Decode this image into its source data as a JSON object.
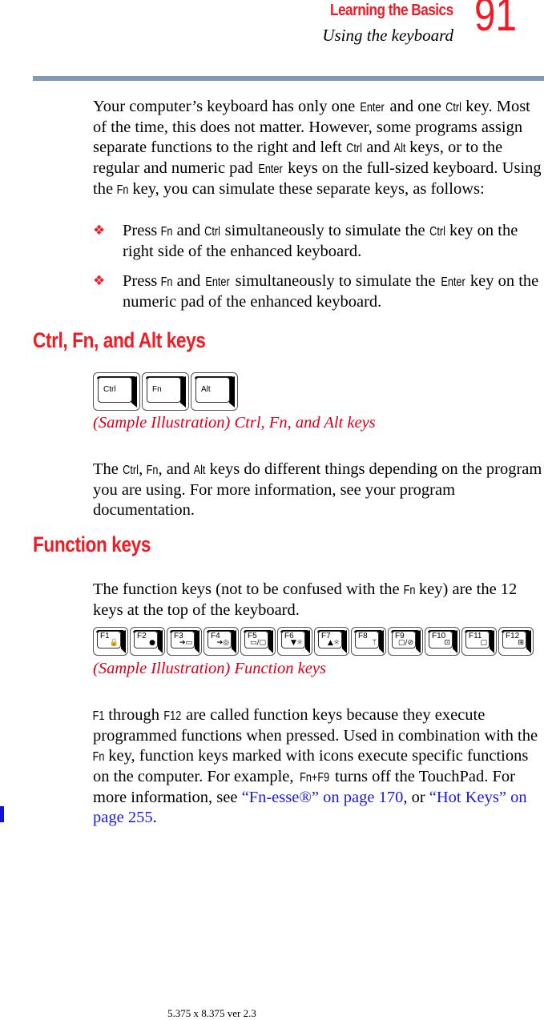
{
  "header": {
    "chapter": "Learning the Basics",
    "section": "Using the keyboard",
    "page_number": "91",
    "rule_color": "#7f9bb4",
    "accent_color": "#ee1c25"
  },
  "intro": {
    "s1": "Your computer’s keyboard has only one ",
    "k1": "Enter",
    "s2": " and one ",
    "k2": "Ctrl",
    "s3": " key. Most of the time, this does not matter. However, some programs assign separate functions to the right and left ",
    "k3": "Ctrl",
    "s4": " and ",
    "k4": "Alt",
    "s5": " keys, or to the regular and numeric pad ",
    "k5": "Enter",
    "s6": " keys on the full-sized keyboard. Using the ",
    "k6": "Fn",
    "s7": " key, you can simulate these separate keys, as follows:"
  },
  "bullets": [
    {
      "glyph": "❖",
      "s1": "Press ",
      "k1": "Fn",
      "s2": " and ",
      "k2": "Ctrl",
      "s3": " simultaneously to simulate the ",
      "k3": "Ctrl",
      "s4": " key on the right side of the enhanced keyboard."
    },
    {
      "glyph": "❖",
      "s1": "Press ",
      "k1": "Fn",
      "s2": " and ",
      "k2": "Enter",
      "s3": " simultaneously to simulate the ",
      "k3": "Enter",
      "s4": " key on the numeric pad of the enhanced keyboard."
    }
  ],
  "section1": {
    "heading": "Ctrl, Fn, and Alt keys",
    "keys": [
      "Ctrl",
      "Fn",
      "Alt"
    ],
    "caption": "(Sample Illustration) Ctrl, Fn, and Alt keys",
    "p": {
      "s1": "The ",
      "k1": "Ctrl",
      "s2": ", ",
      "k2": "Fn",
      "s3": ", and ",
      "k3": "Alt",
      "s4": " keys do different things depending on the program you are using. For more information, see your program documentation."
    }
  },
  "section2": {
    "heading": "Function keys",
    "p1": {
      "s1": "The function keys (not to be confused with the ",
      "k1": "Fn",
      "s2": " key) are the 12 keys at the top of the keyboard."
    },
    "fkeys": [
      {
        "label": "F1",
        "icon": "🔒",
        "icon_name": "lock-icon"
      },
      {
        "label": "F2",
        "icon": "●",
        "icon_name": "power-icon"
      },
      {
        "label": "F3",
        "icon": "➔▭",
        "icon_name": "standby-icon"
      },
      {
        "label": "F4",
        "icon": "➔◎",
        "icon_name": "hibernate-icon"
      },
      {
        "label": "F5",
        "icon": "▭/▢",
        "icon_name": "display-toggle-icon"
      },
      {
        "label": "F6",
        "icon": "▼☼",
        "icon_name": "brightness-down-icon"
      },
      {
        "label": "F7",
        "icon": "▲☼",
        "icon_name": "brightness-up-icon"
      },
      {
        "label": "F8",
        "icon": "ᛘ",
        "icon_name": "wireless-icon"
      },
      {
        "label": "F9",
        "icon": "▢/⊘",
        "icon_name": "touchpad-icon"
      },
      {
        "label": "F10",
        "icon": "⊡",
        "icon_name": "arrow-mode-icon"
      },
      {
        "label": "F11",
        "icon": "▢",
        "icon_name": "numeric-mode-icon"
      },
      {
        "label": "F12",
        "icon": "⊞",
        "icon_name": "scroll-lock-icon"
      }
    ],
    "caption": "(Sample Illustration) Function keys",
    "p2": {
      "k1": "F1",
      "s1": " through ",
      "k2": "F12",
      "s2": " are called function keys because they execute programmed functions when pressed. Used in combination with the ",
      "k3": "Fn",
      "s3": " key, function keys marked with icons execute specific functions on the computer. For example, ",
      "k4": "Fn+F9",
      "s4": " turns off the TouchPad. For more information, see ",
      "link1": "“Fn-esse®” on page 170",
      "s5": ", or ",
      "link2": "“Hot Keys” on page 255",
      "s6": "."
    }
  },
  "footer": {
    "text": "5.375 x 8.375 ver 2.3"
  }
}
